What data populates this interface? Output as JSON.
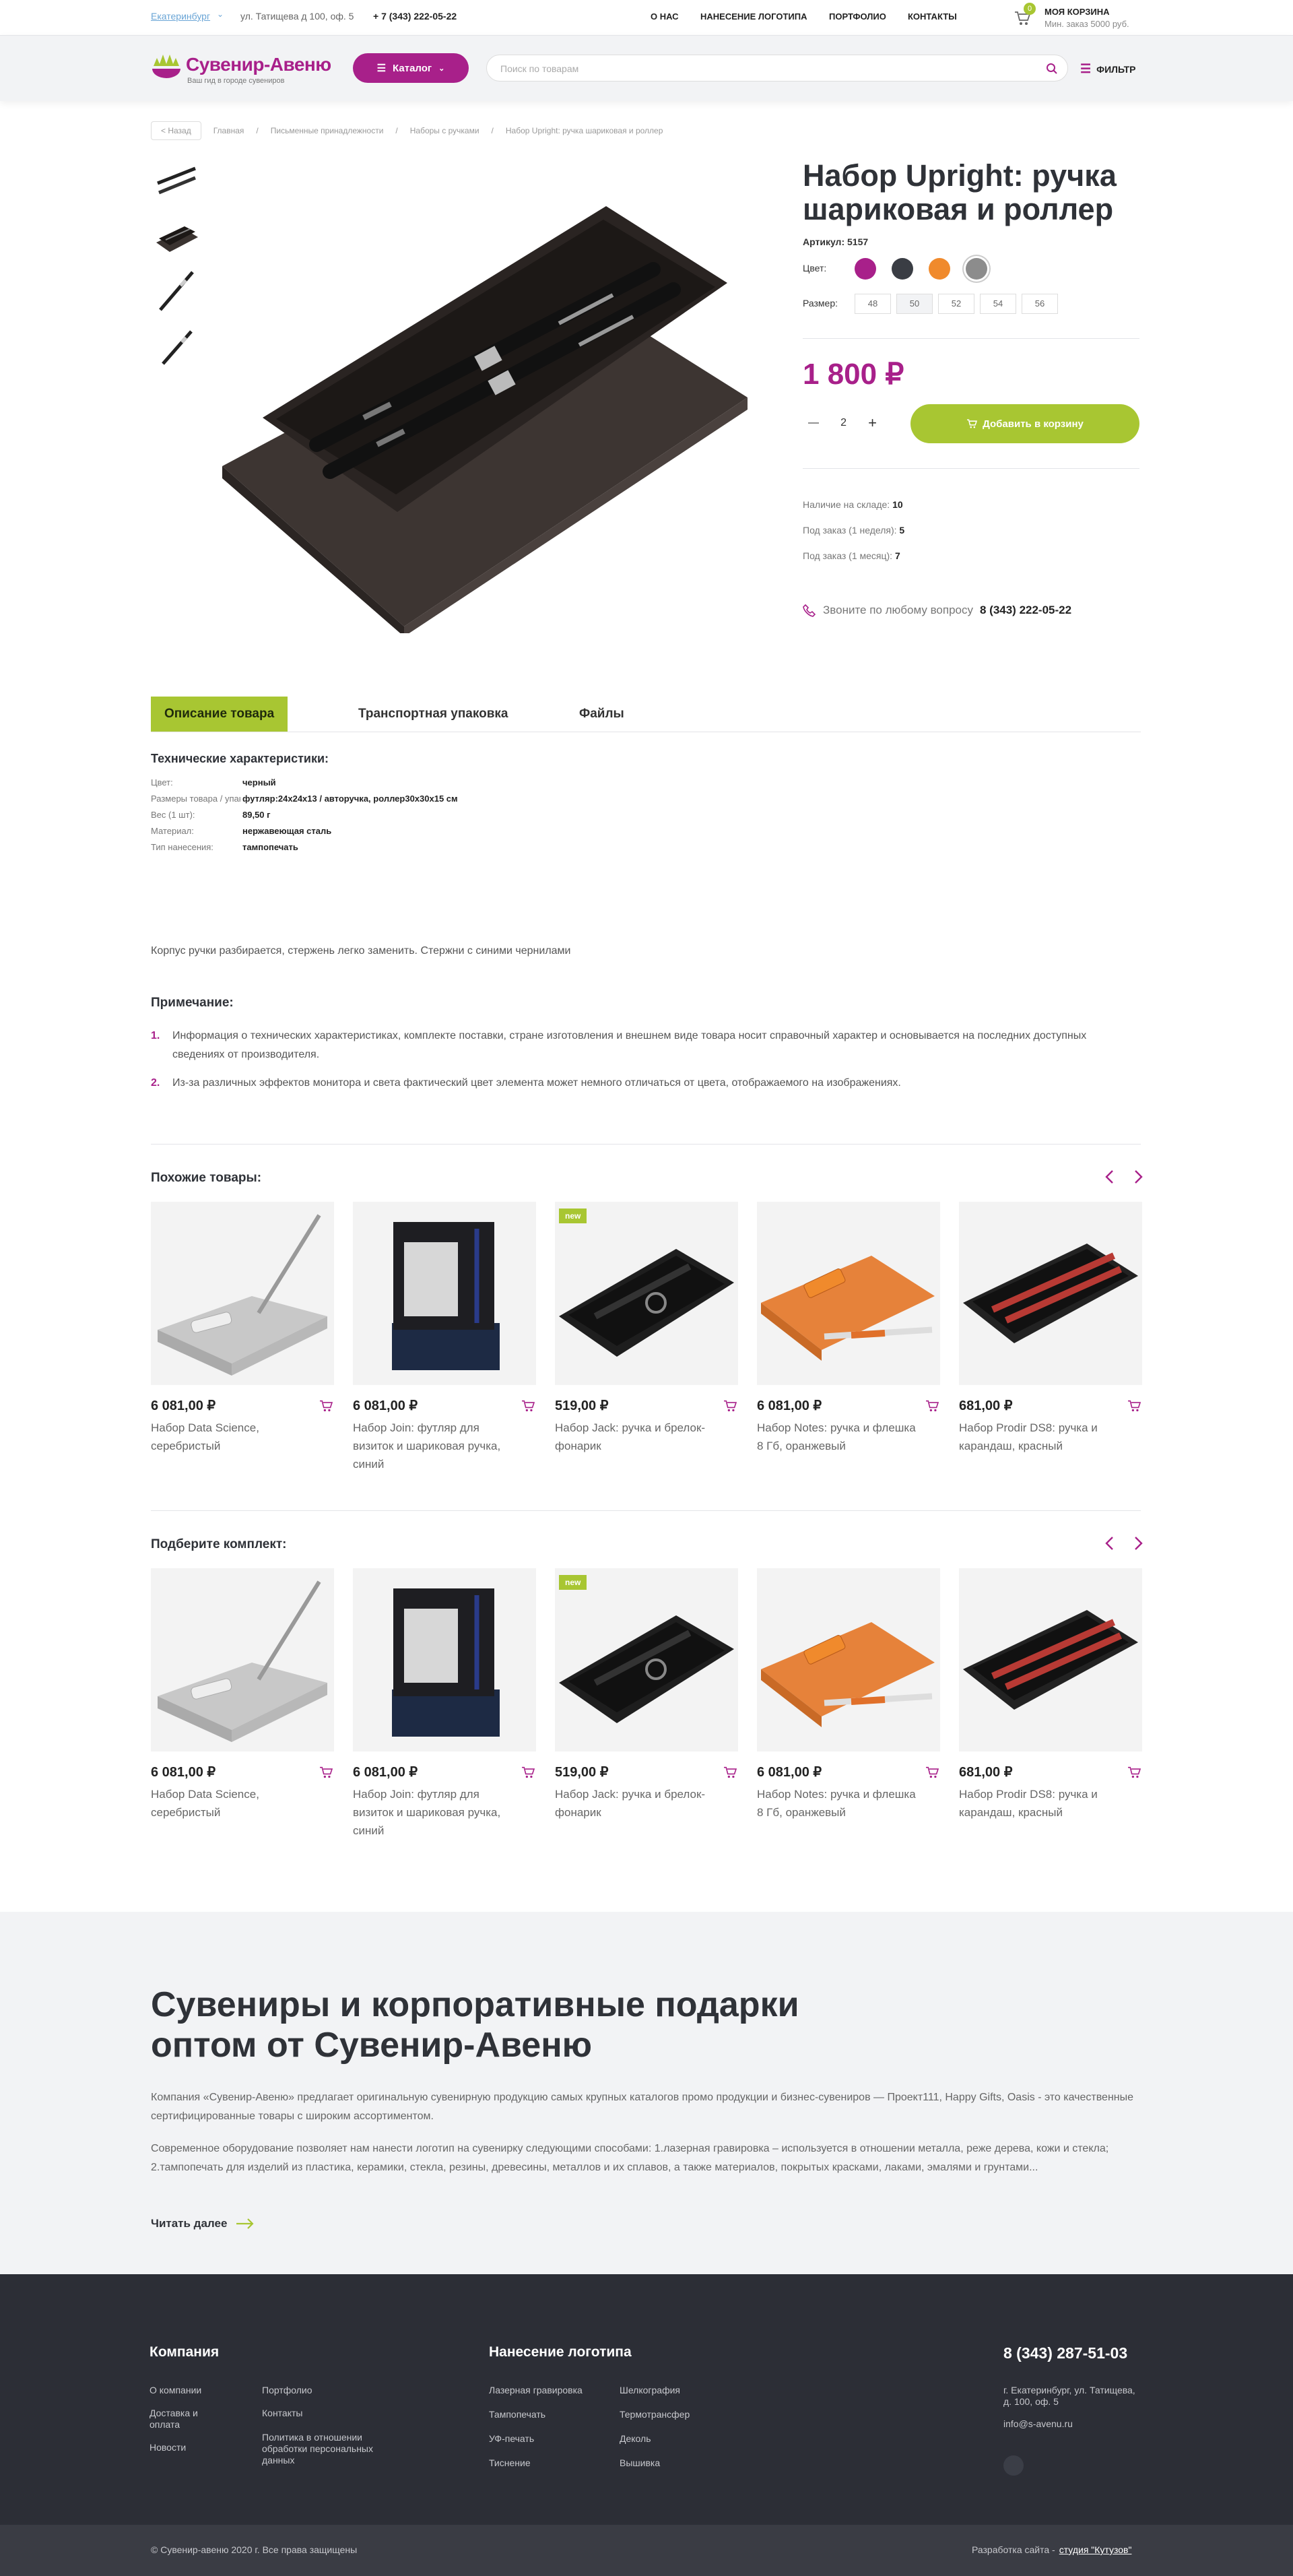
{
  "header": {
    "city": "Екатеринбург",
    "address": "ул. Татищева д 100, оф. 5",
    "phone": "+ 7 (343) 222-05-22",
    "nav": [
      "О НАС",
      "НАНЕСЕНИЕ ЛОГОТИПА",
      "ПОРТФОЛИО",
      "КОНТАКТЫ"
    ],
    "cart_count": "0",
    "cart_title": "МОЯ КОРЗИНА",
    "cart_sub": "Мин. заказ 5000 руб.",
    "logo_text": "Сувенир-Авеню",
    "logo_sub": "Ваш гид в городе сувениров",
    "catalog": "Каталог",
    "search_placeholder": "Поиск по товарам",
    "filter": "ФИЛЬТР"
  },
  "breadcrumbs": [
    "< Назад",
    "Главная",
    "Письменные принадлежности",
    "Наборы с ручками",
    "Набор Upright: ручка шариковая и роллер"
  ],
  "product": {
    "title": "Набор Upright: ручка шариковая и роллер",
    "article_label": "Артикул:",
    "article": "5157",
    "color_label": "Цвет:",
    "colors": [
      "#a8208a",
      "#3a3d44",
      "#f08a2c",
      "#8c8c8c"
    ],
    "size_label": "Размер:",
    "sizes": [
      "48",
      "50",
      "52",
      "54",
      "56"
    ],
    "price": "1 800 ₽",
    "qty": "2",
    "qty_minus": "—",
    "qty_plus": "+",
    "add_to_cart": "Добавить в корзину",
    "stock": [
      {
        "label": "Наличие на складе:",
        "value": "10"
      },
      {
        "label": "Под заказ (1 неделя):",
        "value": "5"
      },
      {
        "label": "Под заказ (1 месяц):",
        "value": "7"
      }
    ],
    "call_text": "Звоните по любому вопросу",
    "call_phone": "8 (343) 222-05-22"
  },
  "tabs": [
    "Описание товара",
    "Транспортная упаковка",
    "Файлы"
  ],
  "specs": {
    "title": "Технические характеристики:",
    "rows": [
      {
        "k": "Цвет:",
        "v": "черный"
      },
      {
        "k": "Размеры товара / упаковки:",
        "v": "футляр:24x24x13 / авторучка, роллер30x30x15 см"
      },
      {
        "k": "Вес (1 шт):",
        "v": "89,50 г"
      },
      {
        "k": "Материал:",
        "v": "нержавеющая сталь"
      },
      {
        "k": "Тип нанесения:",
        "v": "тампопечать"
      }
    ],
    "description": "Корпус ручки разбирается, стержень легко заменить. Стержни с синими чернилами",
    "note_title": "Примечание:",
    "notes": [
      "Информация о технических характеристиках, комплекте поставки, стране изготовления и внешнем виде товара носит справочный характер и основывается на последних доступных сведениях от производителя.",
      "Из-за различных эффектов монитора и света фактический цвет элемента может немного отличаться от цвета, отображаемого на изображениях."
    ]
  },
  "similar": {
    "title": "Похожие товары:",
    "items": [
      {
        "price": "6 081,00 ₽",
        "name": "Набор Data Science, серебристый",
        "badge": ""
      },
      {
        "price": "6 081,00 ₽",
        "name": "Набор Join: футляр для визиток и шариковая ручка, синий",
        "badge": ""
      },
      {
        "price": "519,00 ₽",
        "name": "Набор Jack: ручка и брелок-фонарик",
        "badge": "new"
      },
      {
        "price": "6 081,00 ₽",
        "name": "Набор Notes: ручка и флешка 8 Гб, оранжевый",
        "badge": ""
      },
      {
        "price": "681,00 ₽",
        "name": "Набор Prodir DS8: ручка и карандаш, красный",
        "badge": ""
      }
    ]
  },
  "kit": {
    "title": "Подберите комплект:",
    "items": [
      {
        "price": "6 081,00 ₽",
        "name": "Набор Data Science, серебристый",
        "badge": ""
      },
      {
        "price": "6 081,00 ₽",
        "name": "Набор Join: футляр для визиток и шариковая ручка, синий",
        "badge": ""
      },
      {
        "price": "519,00 ₽",
        "name": "Набор Jack: ручка и брелок-фонарик",
        "badge": "new"
      },
      {
        "price": "6 081,00 ₽",
        "name": "Набор Notes: ручка и флешка 8 Гб, оранжевый",
        "badge": ""
      },
      {
        "price": "681,00 ₽",
        "name": "Набор Prodir DS8: ручка и карандаш, красный",
        "badge": ""
      }
    ]
  },
  "seo": {
    "title": "Сувениры и корпоративные подарки оптом от Сувенир-Авеню",
    "p1": "Компания «Сувенир-Авеню» предлагает оригинальную сувенирную продукцию самых крупных каталогов промо продукции и бизнес-сувениров — Проект111, Happy Gifts, Oasis - это качественные сертифицированные товары с широким ассортиментом.",
    "p2": "Современное оборудование позволяет нам нанести логотип на сувенирку следующими способами: 1.лазерная гравировка – используется в отношении металла, реже дерева, кожи и стекла; 2.тампопечать для изделий из пластика, керамики, стекла, резины, древесины, металлов и их сплавов, а также материалов, покрытых красками, лаками, эмалями и грунтами...",
    "more": "Читать далее"
  },
  "footer": {
    "company_title": "Компания",
    "company_col1": [
      "О компании",
      "Доставка и оплата",
      "Новости"
    ],
    "company_col2": [
      "Портфолио",
      "Контакты",
      "Политика в отношении обработки персональных данных"
    ],
    "logo_title": "Нанесение логотипа",
    "logo_col1": [
      "Лазерная гравировка",
      "Тампопечать",
      "УФ-печать",
      "Тиснение"
    ],
    "logo_col2": [
      "Шелкография",
      "Термотрансфер",
      "Деколь",
      "Вышивка"
    ],
    "phone": "8 (343) 287-51-03",
    "address": "г. Екатеринбург, ул. Татищева, д. 100, оф. 5",
    "email": "info@s-avenu.ru",
    "copyright": "© Сувенир-авеню 2020 г.  Все права защищены",
    "dev_text": "Разработка сайта -",
    "dev_link": "студия \"Кутузов\""
  },
  "colors": {
    "accent": "#a8208a",
    "green": "#a8c632",
    "dark": "#2c2e36"
  }
}
